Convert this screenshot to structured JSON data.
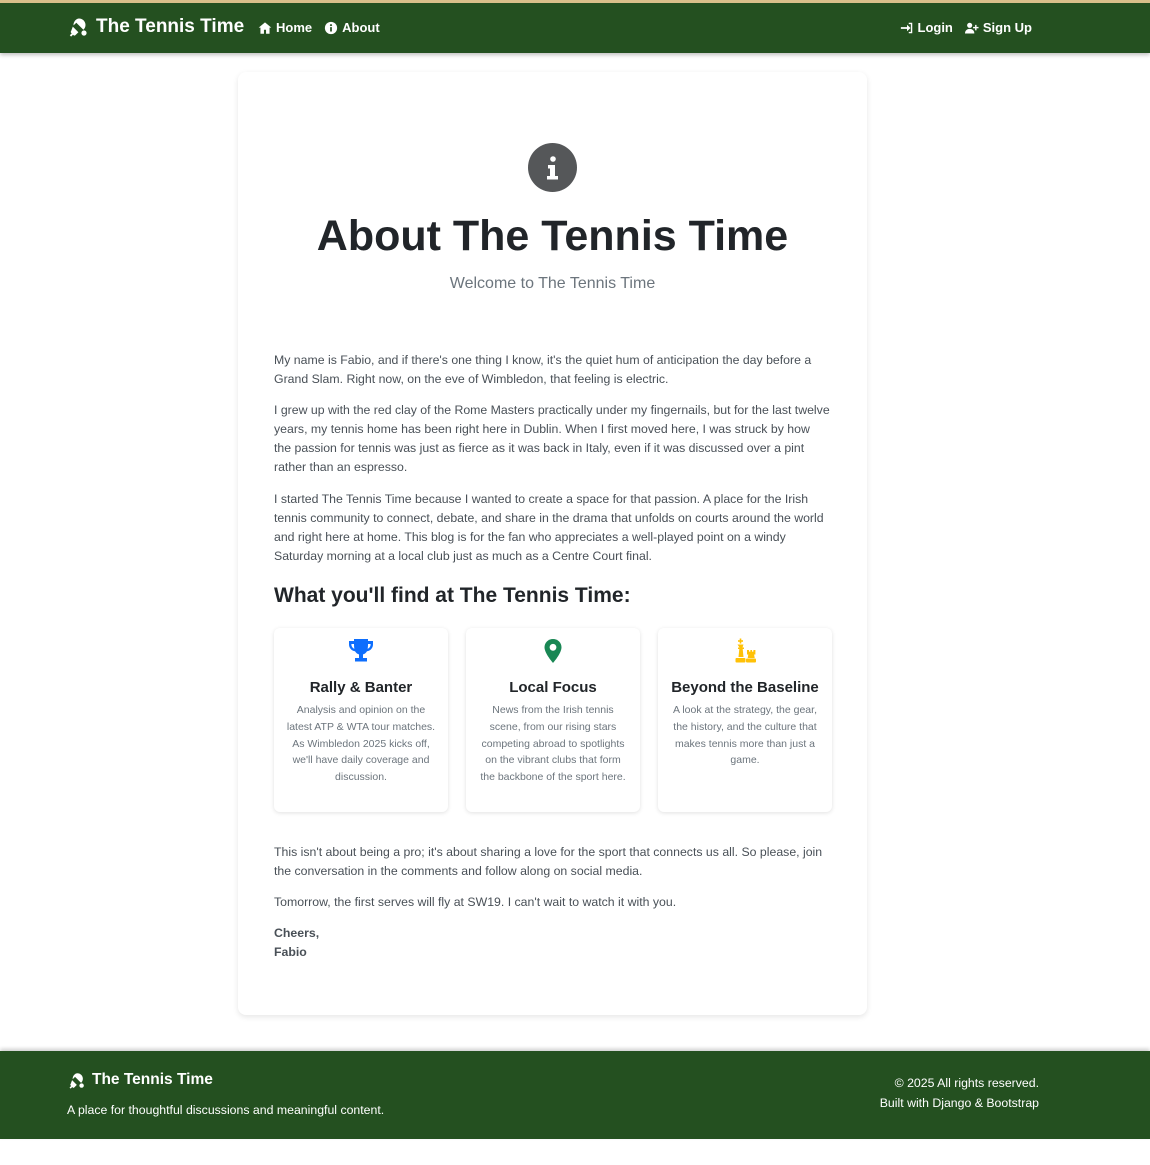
{
  "nav": {
    "brand": "The Tennis Time",
    "home": "Home",
    "about": "About",
    "login": "Login",
    "signup": "Sign Up"
  },
  "about": {
    "title": "About The Tennis Time",
    "subtitle": "Welcome to The Tennis Time",
    "p1": "My name is Fabio, and if there's one thing I know, it's the quiet hum of anticipation the day before a Grand Slam. Right now, on the eve of Wimbledon, that feeling is electric.",
    "p2": "I grew up with the red clay of the Rome Masters practically under my fingernails, but for the last twelve years, my tennis home has been right here in Dublin. When I first moved here, I was struck by how the passion for tennis was just as fierce as it was back in Italy, even if it was discussed over a pint rather than an espresso.",
    "p3": "I started The Tennis Time because I wanted to create a space for that passion. A place for the Irish tennis community to connect, debate, and share in the drama that unfolds on courts around the world and right here at home. This blog is for the fan who appreciates a well-played point on a windy Saturday morning at a local club just as much as a Centre Court final.",
    "section_title": "What you'll find at The Tennis Time:",
    "features": [
      {
        "icon": "trophy-icon",
        "color": "#0d6efd",
        "title": "Rally & Banter",
        "desc": "Analysis and opinion on the latest ATP & WTA tour matches. As Wimbledon 2025 kicks off, we'll have daily coverage and discussion."
      },
      {
        "icon": "map-pin-icon",
        "color": "#198754",
        "title": "Local Focus",
        "desc": "News from the Irish tennis scene, from our rising stars competing abroad to spotlights on the vibrant clubs that form the backbone of the sport here."
      },
      {
        "icon": "chess-icon",
        "color": "#ffc107",
        "title": "Beyond the Baseline",
        "desc": "A look at the strategy, the gear, the history, and the culture that makes tennis more than just a game."
      }
    ],
    "p4": "This isn't about being a pro; it's about sharing a love for the sport that connects us all. So please, join the conversation in the comments and follow along on social media.",
    "p5": "Tomorrow, the first serves will fly at SW19. I can't wait to watch it with you.",
    "signoff_1": "Cheers,",
    "signoff_2": "Fabio"
  },
  "footer": {
    "brand": "The Tennis Time",
    "tagline": "A place for thoughtful discussions and meaningful content.",
    "copyright": "© 2025 All rights reserved.",
    "built_with": "Built with Django & Bootstrap"
  },
  "colors": {
    "nav_bg": "#245020",
    "accent_border": "#d9c08a"
  }
}
